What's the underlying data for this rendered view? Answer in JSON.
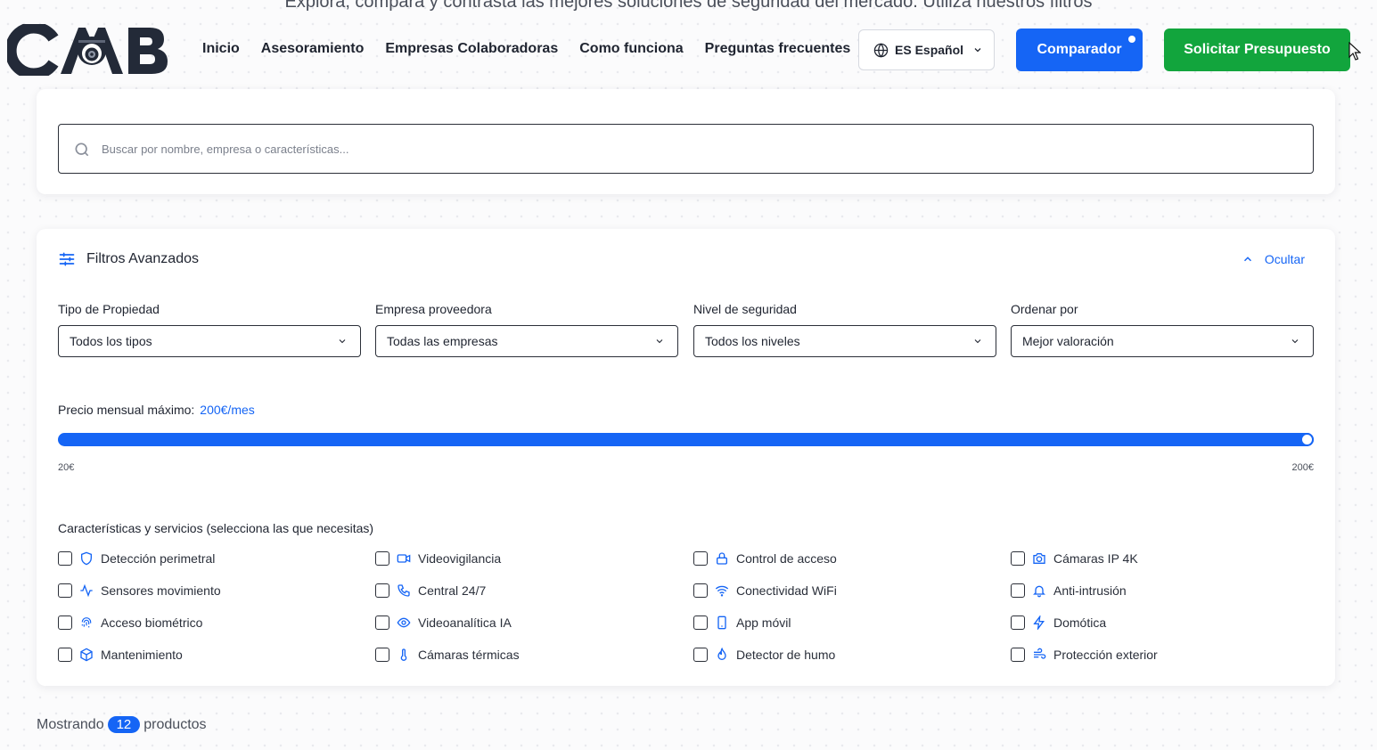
{
  "hero": {
    "partial_text": "Explora, compara y contrasta las mejores soluciones de seguridad del mercado. Utiliza nuestros filtros"
  },
  "brand": {
    "logo_text": "CMB",
    "dark_color": "#232a38"
  },
  "nav": {
    "links": [
      "Inicio",
      "Asesoramiento",
      "Empresas Colaboradoras",
      "Como funciona",
      "Preguntas frecuentes"
    ],
    "language_label": "ES Español",
    "comparador_label": "Comparador",
    "presupuesto_label": "Solicitar Presupuesto"
  },
  "search": {
    "placeholder": "Buscar por nombre, empresa o características...",
    "value": ""
  },
  "filters": {
    "title": "Filtros Avanzados",
    "toggle_label": "Ocultar",
    "selects": [
      {
        "label": "Tipo de Propiedad",
        "value": "Todos los tipos"
      },
      {
        "label": "Empresa proveedora",
        "value": "Todas las empresas"
      },
      {
        "label": "Nivel de seguridad",
        "value": "Todos los niveles"
      },
      {
        "label": "Ordenar por",
        "value": "Mejor valoración"
      }
    ],
    "price": {
      "label": "Precio mensual máximo:",
      "value_text": "200€/mes",
      "min_label": "20€",
      "max_label": "200€",
      "min": 20,
      "max": 200,
      "current": 200
    },
    "features_label": "Características y servicios (selecciona las que necesitas)",
    "features": [
      {
        "label": "Detección perimetral",
        "icon": "shield-icon",
        "checked": false
      },
      {
        "label": "Videovigilancia",
        "icon": "video-camera-icon",
        "checked": false
      },
      {
        "label": "Control de acceso",
        "icon": "lock-icon",
        "checked": false
      },
      {
        "label": "Cámaras IP 4K",
        "icon": "camera-icon",
        "checked": false
      },
      {
        "label": "Sensores movimiento",
        "icon": "activity-icon",
        "checked": false
      },
      {
        "label": "Central 24/7",
        "icon": "phone-icon",
        "checked": false
      },
      {
        "label": "Conectividad WiFi",
        "icon": "wifi-icon",
        "checked": false
      },
      {
        "label": "Anti-intrusión",
        "icon": "bell-icon",
        "checked": false
      },
      {
        "label": "Acceso biométrico",
        "icon": "fingerprint-icon",
        "checked": false
      },
      {
        "label": "Videoanalítica IA",
        "icon": "eye-icon",
        "checked": false
      },
      {
        "label": "App móvil",
        "icon": "smartphone-icon",
        "checked": false
      },
      {
        "label": "Domótica",
        "icon": "bolt-icon",
        "checked": false
      },
      {
        "label": "Mantenimiento",
        "icon": "box-icon",
        "checked": false
      },
      {
        "label": "Cámaras térmicas",
        "icon": "thermometer-icon",
        "checked": false
      },
      {
        "label": "Detector de humo",
        "icon": "flame-icon",
        "checked": false
      },
      {
        "label": "Protección exterior",
        "icon": "wind-icon",
        "checked": false
      }
    ]
  },
  "results": {
    "prefix": "Mostrando",
    "count": "12",
    "suffix": "productos"
  },
  "colors": {
    "primary": "#1565f5",
    "success": "#12a53d",
    "text": "#1f2430"
  }
}
